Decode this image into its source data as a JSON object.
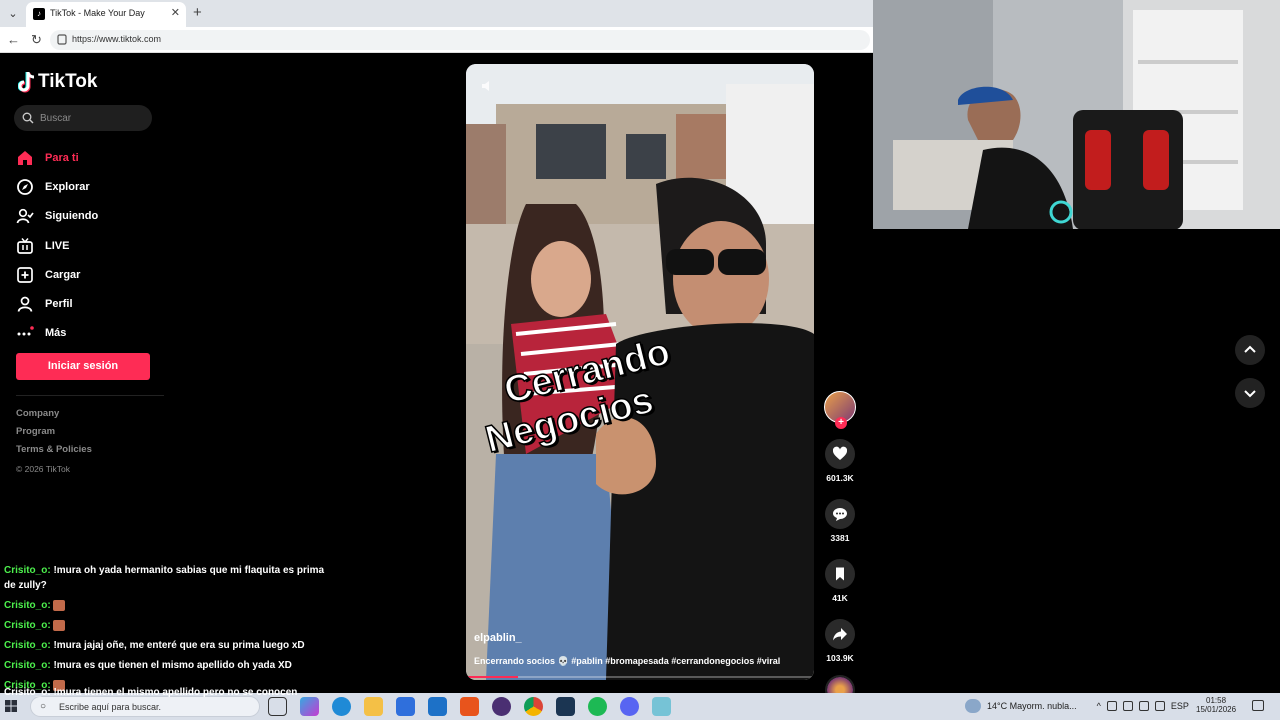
{
  "browser": {
    "tab_title": "TikTok - Make Your Day",
    "url": "https://www.tiktok.com"
  },
  "sidebar": {
    "logo": "TikTok",
    "search_placeholder": "Buscar",
    "items": [
      {
        "label": "Para ti",
        "icon": "home-icon",
        "active": true
      },
      {
        "label": "Explorar",
        "icon": "compass-icon",
        "active": false
      },
      {
        "label": "Siguiendo",
        "icon": "users-icon",
        "active": false
      },
      {
        "label": "LIVE",
        "icon": "live-icon",
        "active": false
      },
      {
        "label": "Cargar",
        "icon": "upload-icon",
        "active": false
      },
      {
        "label": "Perfil",
        "icon": "profile-icon",
        "active": false
      },
      {
        "label": "Más",
        "icon": "more-icon",
        "active": false
      }
    ],
    "login_label": "Iniciar sesión",
    "footer": [
      "Company",
      "Program",
      "Terms & Policies"
    ],
    "copyright": "© 2026 TikTok"
  },
  "chat": [
    {
      "user": "Crisito_o:",
      "text": "!mura oh yada hermanito sabias que mi flaquita es prima de zully?",
      "emote": false
    },
    {
      "user": "Crisito_o:",
      "text": "",
      "emote": true
    },
    {
      "user": "Crisito_o:",
      "text": "",
      "emote": true
    },
    {
      "user": "Crisito_o:",
      "text": "!mura jajaj oñe, me enteré que era su prima luego xD",
      "emote": false
    },
    {
      "user": "Crisito_o:",
      "text": "!mura es que tienen el mismo apellido oh yada XD",
      "emote": false
    },
    {
      "user": "Crisito_o:",
      "text": "",
      "emote": true
    },
    {
      "user": "Crisito_o:",
      "text": "",
      "emote": true
    },
    {
      "user": "Crisito_o:",
      "text": "",
      "emote": true
    }
  ],
  "chat_overflow": "Crisito_o: !mura tienen el mismo apellido pero no se conocen",
  "video": {
    "caption_line1": "Cerrando",
    "caption_line2": "Negocios",
    "author": "elpablin_",
    "description": "Encerrando socios 💀 #pablin #bromapesada #cerrandonegocios #viral",
    "progress": 0.15
  },
  "actions": {
    "likes": "601.3K",
    "comments": "3381",
    "saves": "41K",
    "shares": "103.9K"
  },
  "taskbar": {
    "search_text": "Escribe aquí para buscar.",
    "weather": "14°C  Mayorm. nubla...",
    "lang": "ESP",
    "time": "01:58",
    "date": "15/01/2026"
  }
}
